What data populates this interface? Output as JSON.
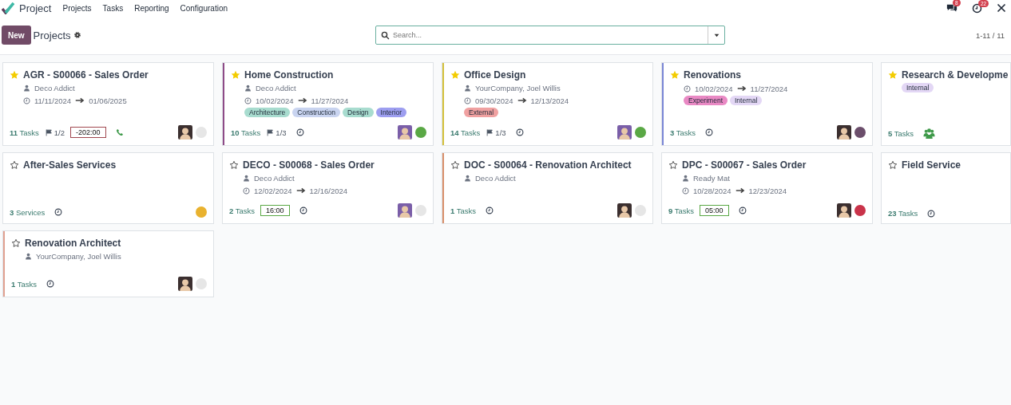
{
  "navbar": {
    "app_name": "Project",
    "menu": [
      "Projects",
      "Tasks",
      "Reporting",
      "Configuration"
    ],
    "messages_badge": "8",
    "activities_badge": "22"
  },
  "control_panel": {
    "new_button": "New",
    "breadcrumb": "Projects",
    "search": {
      "placeholder": "Search..."
    },
    "pager": "1-11 / 11"
  },
  "cards": [
    {
      "title": "AGR - S00066 - Sales Order",
      "starred": true,
      "customer": "Deco Addict",
      "start": "11/11/2024",
      "end": "01/06/2025",
      "count": "11",
      "count_label": "Tasks",
      "milestone": "1/2",
      "time": {
        "text": "-202:00",
        "kind": "overdue"
      },
      "activity": {
        "kind": "phone"
      },
      "avatar": {
        "kind": "cartoon"
      },
      "status": {
        "color": "#e6e6e6"
      }
    },
    {
      "title": "Home Construction",
      "starred": true,
      "color": "#8e4b88",
      "customer": "Deco Addict",
      "start": "10/02/2024",
      "end": "11/27/2024",
      "tags": [
        {
          "label": "Architecture",
          "color": "#a8dccf"
        },
        {
          "label": "Construction",
          "color": "#c9d4f0"
        },
        {
          "label": "Design",
          "color": "#a8dccf"
        },
        {
          "label": "Interior",
          "color": "#9d9ef0"
        }
      ],
      "count": "10",
      "count_label": "Tasks",
      "milestone": "1/3",
      "activity": {
        "kind": "clock"
      },
      "avatar": {
        "kind": "photo"
      },
      "status": {
        "color": "#5aa845"
      }
    },
    {
      "title": "Office Design",
      "starred": true,
      "color": "#d4c13b",
      "customer": "YourCompany, Joel Willis",
      "start": "09/30/2024",
      "end": "12/13/2024",
      "tags": [
        {
          "label": "External",
          "color": "#f0a1a1"
        }
      ],
      "count": "14",
      "count_label": "Tasks",
      "milestone": "1/3",
      "activity": {
        "kind": "clock"
      },
      "avatar": {
        "kind": "photo"
      },
      "status": {
        "color": "#5aa845"
      }
    },
    {
      "title": "Renovations",
      "starred": true,
      "color": "#7a86d6",
      "start": "10/02/2024",
      "end": "11/27/2024",
      "tags": [
        {
          "label": "Experiment",
          "color": "#e989c4"
        },
        {
          "label": "Internal",
          "color": "#e3d7f5"
        }
      ],
      "count": "3",
      "count_label": "Tasks",
      "activity": {
        "kind": "clock"
      },
      "avatar": {
        "kind": "cartoon"
      },
      "status": {
        "color": "#6b4e6b"
      }
    },
    {
      "title": "Research & Developme",
      "starred": true,
      "tags": [
        {
          "label": "Internal",
          "color": "#e3d7f5"
        }
      ],
      "count": "5",
      "count_label": "Tasks",
      "activity": {
        "kind": "group"
      }
    },
    {
      "title": "After-Sales Services",
      "starred": false,
      "count": "3",
      "count_label": "Services",
      "activity": {
        "kind": "clock"
      },
      "status": {
        "color": "#e9b22f"
      }
    },
    {
      "title": "DECO - S00068 - Sales Order",
      "starred": false,
      "customer": "Deco Addict",
      "start": "12/02/2024",
      "end": "12/16/2024",
      "count": "2",
      "count_label": "Tasks",
      "time": {
        "text": "16:00",
        "kind": "ok"
      },
      "activity": {
        "kind": "clock"
      },
      "avatar": {
        "kind": "photo"
      },
      "status": {
        "color": "#e6e6e6"
      }
    },
    {
      "title": "DOC - S00064 - Renovation Architect",
      "starred": false,
      "color": "#d9906b",
      "customer": "Deco Addict",
      "count": "1",
      "count_label": "Tasks",
      "activity": {
        "kind": "clock"
      },
      "avatar": {
        "kind": "cartoon"
      },
      "status": {
        "color": "#e6e6e6"
      }
    },
    {
      "title": "DPC - S00067 - Sales Order",
      "starred": false,
      "customer": "Ready Mat",
      "start": "10/28/2024",
      "end": "12/23/2024",
      "count": "9",
      "count_label": "Tasks",
      "time": {
        "text": "05:00",
        "kind": "ok"
      },
      "activity": {
        "kind": "clock"
      },
      "avatar": {
        "kind": "cartoon"
      },
      "status": {
        "color": "#c9334a"
      }
    },
    {
      "title": "Field Service",
      "starred": false,
      "count": "23",
      "count_label": "Tasks",
      "activity": {
        "kind": "clock"
      }
    },
    {
      "title": "Renovation Architect",
      "starred": false,
      "color": "#e0a090",
      "customer": "YourCompany, Joel Willis",
      "count": "1",
      "count_label": "Tasks",
      "activity": {
        "kind": "clock"
      },
      "avatar": {
        "kind": "cartoon"
      },
      "status": {
        "color": "#e6e6e6"
      }
    }
  ]
}
